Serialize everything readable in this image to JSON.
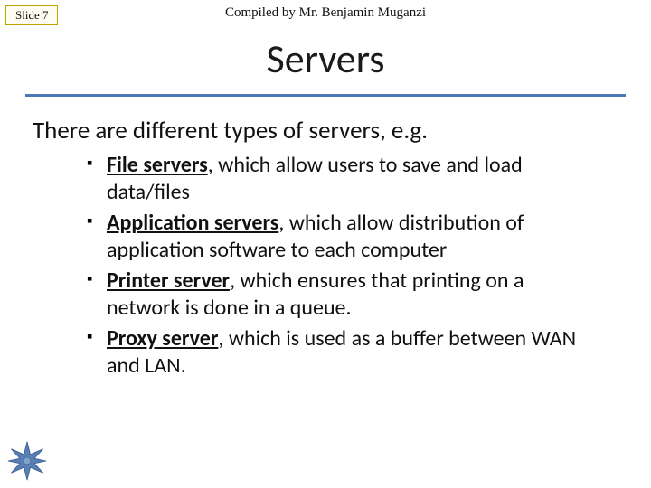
{
  "header": {
    "slide_label": "Slide 7",
    "compiled_by": "Compiled by Mr. Benjamin Muganzi"
  },
  "title": "Servers",
  "intro": "There are different types of servers, e.g.",
  "bullets": [
    {
      "term": "File servers",
      "rest": ", which allow users to save and load data/files"
    },
    {
      "term": "Application servers",
      "rest": ", which allow distribution of application software to each computer"
    },
    {
      "term": "Printer server",
      "rest": ", which ensures  that printing on a network is done in a queue."
    },
    {
      "term": "Proxy server",
      "rest": ", which is used as a buffer between WAN and LAN."
    }
  ],
  "icons": {
    "star_fill": "#5a7fb5",
    "star_stroke": "#3a5f95"
  }
}
